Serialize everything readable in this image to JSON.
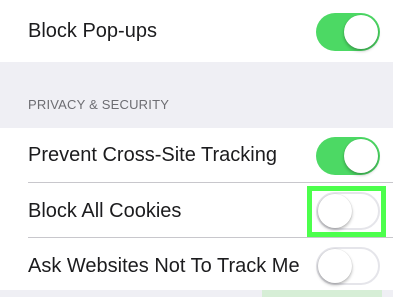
{
  "rows": {
    "block_popups": {
      "label": "Block Pop-ups",
      "enabled": true
    },
    "prevent_cross_site_tracking": {
      "label": "Prevent Cross-Site Tracking",
      "enabled": true
    },
    "block_all_cookies": {
      "label": "Block All Cookies",
      "enabled": false
    },
    "ask_not_to_track": {
      "label": "Ask Websites Not To Track Me",
      "enabled": false
    }
  },
  "section": {
    "privacy_header": "PRIVACY & SECURITY"
  },
  "colors": {
    "toggle_on": "#4cd964",
    "highlight": "#4cff4c",
    "group_background": "#efeff4"
  }
}
